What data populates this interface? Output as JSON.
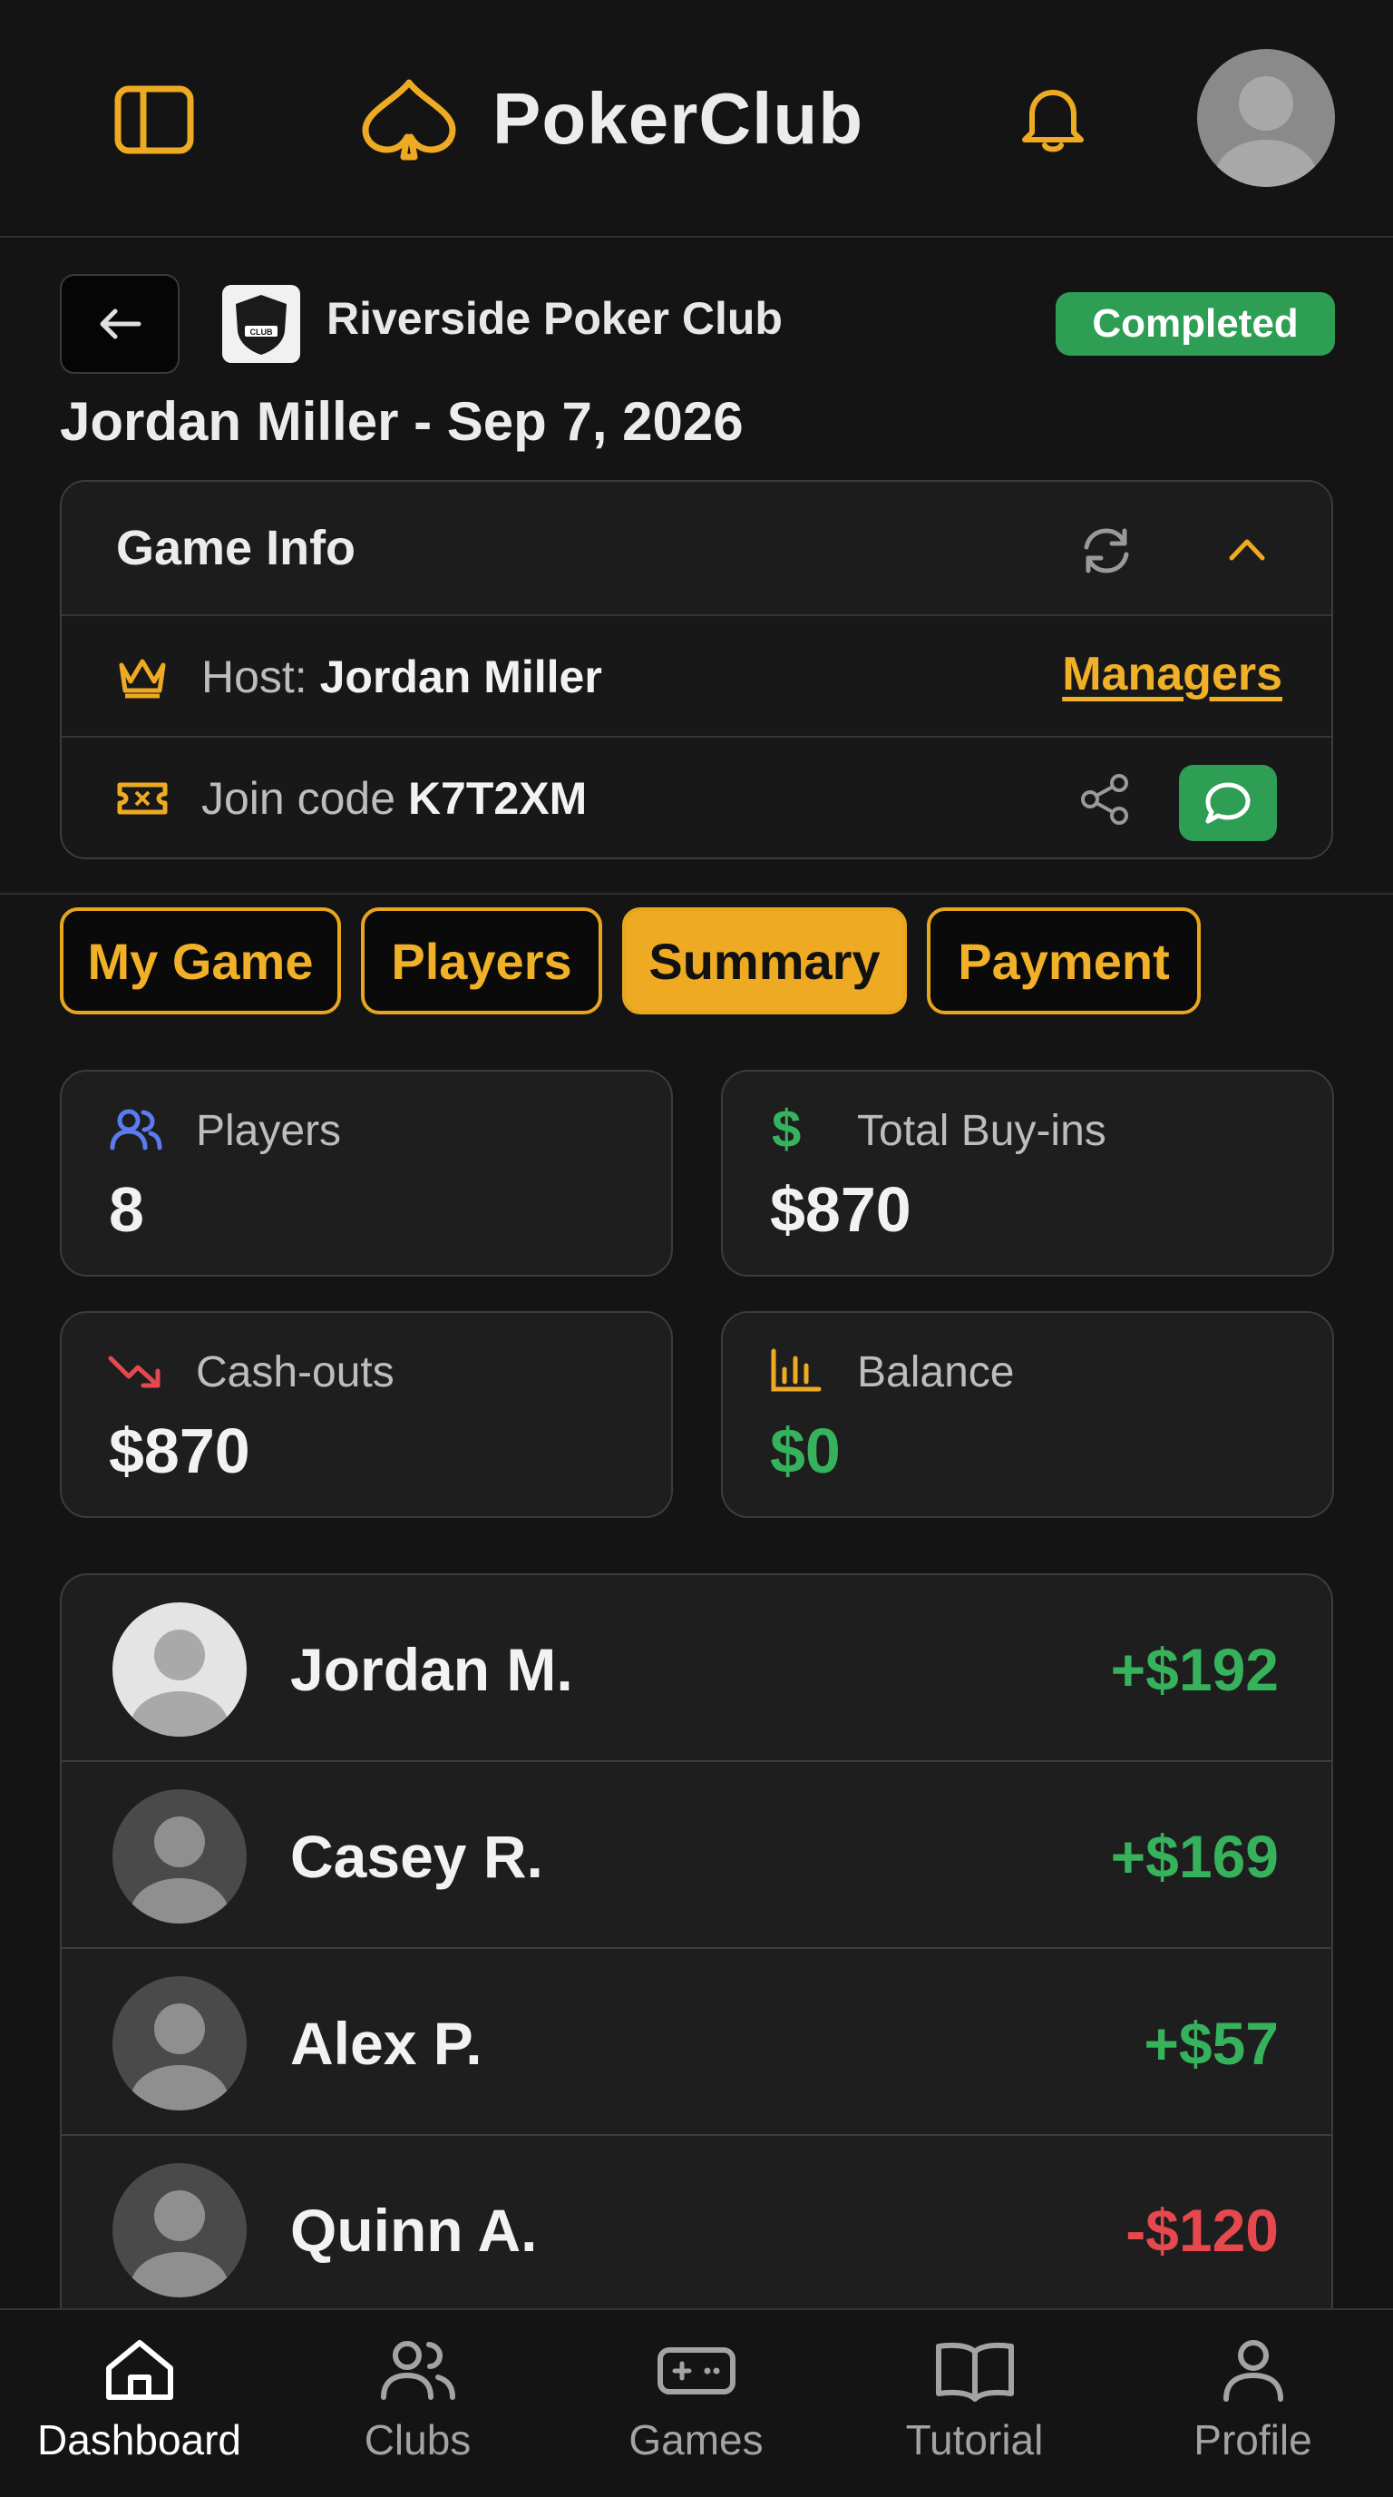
{
  "header": {
    "app_name": "PokerClub",
    "icons": [
      "sidebar-toggle-icon",
      "spade-icon",
      "bell-icon",
      "avatar"
    ]
  },
  "club": {
    "name": "Riverside Poker Club",
    "logo_text": "CLUB",
    "status": "Completed"
  },
  "game": {
    "title": "Jordan Miller - Sep 7, 2026"
  },
  "game_info": {
    "title": "Game Info",
    "host_label": "Host:",
    "host_name": "Jordan Miller",
    "managers_link": "Managers",
    "join_label": "Join code",
    "join_code": "K7T2XM"
  },
  "tabs": [
    {
      "label": "My Game",
      "active": false
    },
    {
      "label": "Players",
      "active": false
    },
    {
      "label": "Summary",
      "active": true
    },
    {
      "label": "Payment",
      "active": false
    }
  ],
  "stats": {
    "players": {
      "label": "Players",
      "value": "8",
      "icon": "users-icon"
    },
    "buyins": {
      "label": "Total Buy-ins",
      "value": "$870",
      "icon": "dollar-icon"
    },
    "cashouts": {
      "label": "Cash-outs",
      "value": "$870",
      "icon": "trending-down-icon"
    },
    "balance": {
      "label": "Balance",
      "value": "$0",
      "icon": "bar-chart-icon"
    }
  },
  "players": [
    {
      "name": "Jordan M.",
      "amount": "+$192"
    },
    {
      "name": "Casey R.",
      "amount": "+$169"
    },
    {
      "name": "Alex P.",
      "amount": "+$57"
    },
    {
      "name": "Quinn A.",
      "amount": "-$120"
    }
  ],
  "nav": [
    {
      "label": "Dashboard",
      "icon": "home-icon",
      "active": true
    },
    {
      "label": "Clubs",
      "icon": "users-icon",
      "active": false
    },
    {
      "label": "Games",
      "icon": "gamepad-icon",
      "active": false
    },
    {
      "label": "Tutorial",
      "icon": "book-icon",
      "active": false
    },
    {
      "label": "Profile",
      "icon": "user-icon",
      "active": false
    }
  ],
  "colors": {
    "background": "#141414",
    "accent": "#EDAA22",
    "positive": "#36B25C",
    "negative": "#E5484D",
    "badge": "#2E9E55"
  }
}
